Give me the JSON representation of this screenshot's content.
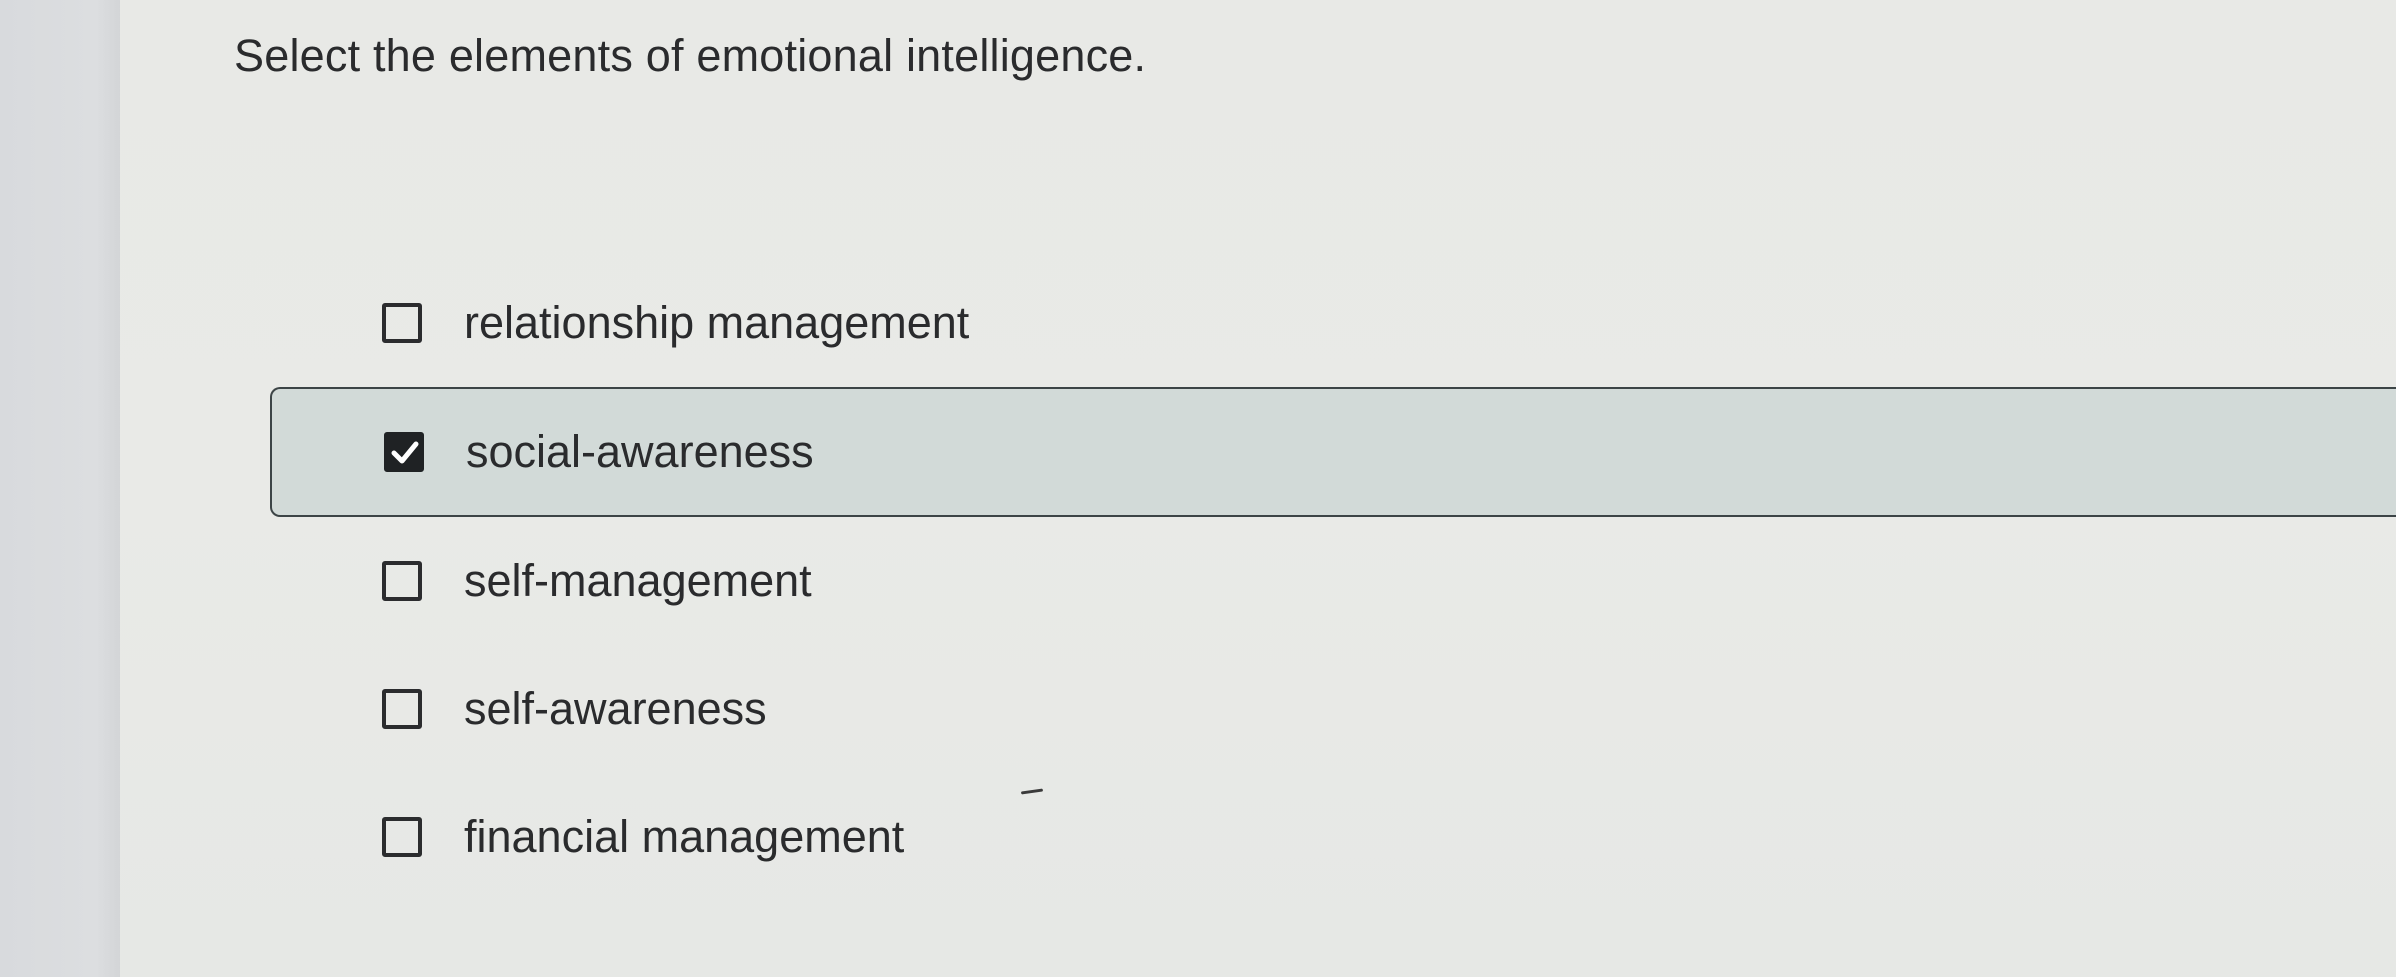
{
  "question": "Select the elements of emotional intelligence.",
  "options": [
    {
      "label": "relationship management",
      "checked": false
    },
    {
      "label": "social-awareness",
      "checked": true
    },
    {
      "label": "self-management",
      "checked": false
    },
    {
      "label": "self-awareness",
      "checked": false
    },
    {
      "label": "financial management",
      "checked": false
    }
  ],
  "colors": {
    "selected_row_bg": "#d2dad8",
    "checkbox_fill": "#1f2224",
    "text": "#2a2b2d"
  },
  "icons": {
    "checked": "checkmark-icon"
  }
}
